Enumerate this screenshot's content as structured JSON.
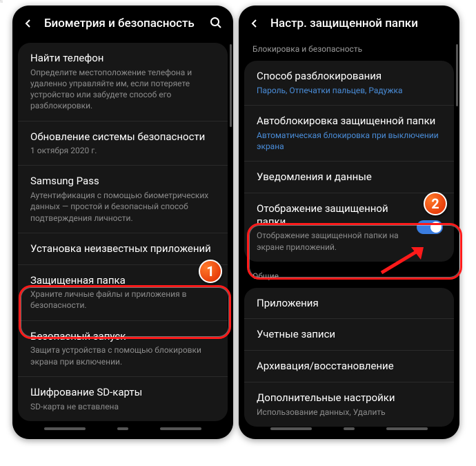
{
  "colors": {
    "accent": "#3a7de0",
    "link": "#4a8dd9",
    "highlight": "#ff1a1a"
  },
  "badges": {
    "one": "1",
    "two": "2"
  },
  "left": {
    "title": "Биометрия и безопасность",
    "items": [
      {
        "t": "Найти телефон",
        "s": "Определите местоположение телефона и удаленно управляйте им, если потеряете устройство или забудете способ его разблокировки."
      },
      {
        "t": "Обновление системы безопасности",
        "s": "1 октября 2020 г."
      },
      {
        "t": "Samsung Pass",
        "s": "Аутентификация с помощью биометрических данных — простой и безопасный способ подтверждения личности."
      },
      {
        "t": "Установка неизвестных приложений",
        "s": ""
      },
      {
        "t": "Защищенная папка",
        "s": "Храните личные файлы и приложения в безопасности."
      },
      {
        "t": "Безопасный запуск",
        "s": "Защита устройства с помощью блокировки экрана при включении."
      },
      {
        "t": "Шифрование SD-карты",
        "s": "SD-карта не вставлена"
      }
    ]
  },
  "right": {
    "title": "Настр. защищенной папки",
    "section1": "Блокировка и безопасность",
    "section2": "Общие",
    "g1": [
      {
        "t": "Способ разблокирования",
        "l": "Пароль, Отпечатки пальцев, Радужка"
      },
      {
        "t": "Автоблокировка защищенной папки",
        "l": "Автоматическая блокировка при выключении экрана"
      },
      {
        "t": "Уведомления и данные"
      },
      {
        "t": "Отображение защищенной папки",
        "s": "Отображение защищенной папки на экране приложений.",
        "toggle": true
      }
    ],
    "g2": [
      {
        "t": "Приложения"
      },
      {
        "t": "Учетные записи"
      },
      {
        "t": "Архивация/восстановление"
      },
      {
        "t": "Дополнительные настройки",
        "s": "Использование данных, Удалить"
      }
    ]
  }
}
